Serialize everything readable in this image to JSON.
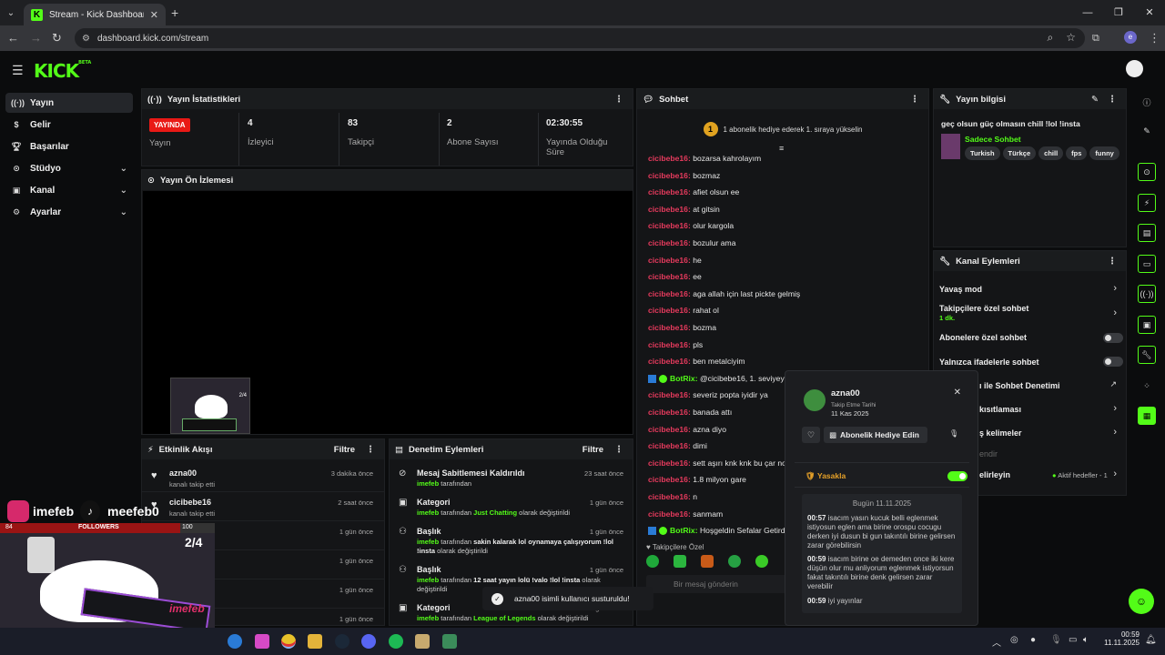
{
  "browser": {
    "tab_title": "Stream - Kick Dashboard",
    "url": "dashboard.kick.com/stream",
    "profile_initial": "e"
  },
  "nav": {
    "items": [
      {
        "label": "Yayın",
        "icon": "broadcast-icon"
      },
      {
        "label": "Gelir",
        "icon": "dollar-icon"
      },
      {
        "label": "Başarılar",
        "icon": "trophy-icon"
      },
      {
        "label": "Stüdyo",
        "icon": "studio-icon"
      },
      {
        "label": "Kanal",
        "icon": "channel-icon"
      },
      {
        "label": "Ayarlar",
        "icon": "gear-icon"
      }
    ]
  },
  "stats": {
    "title": "Yayın İstatistikleri",
    "live_badge": "YAYINDA",
    "live_label": "Yayın",
    "viewers_value": "4",
    "viewers_label": "İzleyici",
    "followers_value": "83",
    "followers_label": "Takipçi",
    "subs_value": "2",
    "subs_label": "Abone Sayısı",
    "uptime_value": "02:30:55",
    "uptime_label": "Yayında Olduğu Süre"
  },
  "preview": {
    "title": "Yayın Ön İzlemesi"
  },
  "activity": {
    "title": "Etkinlik Akışı",
    "filter": "Filtre",
    "events": [
      {
        "name": "azna00",
        "sub": "kanalı takip etti",
        "time": "3 dakika önce"
      },
      {
        "name": "cicibebe16",
        "sub": "kanalı takip etti",
        "time": "2 saat önce"
      },
      {
        "name": "",
        "sub": "",
        "time": "1 gün önce"
      },
      {
        "name": "",
        "sub": "",
        "time": "1 gün önce"
      },
      {
        "name": "",
        "sub": "",
        "time": "1 gün önce"
      },
      {
        "name": "",
        "sub": "",
        "time": "1 gün önce"
      }
    ]
  },
  "moderation": {
    "title": "Denetim Eylemleri",
    "filter": "Filtre",
    "items": [
      {
        "title": "Mesaj Sabitlemesi Kaldırıldı",
        "user": "imefeb",
        "text": "tarafından",
        "time": "23 saat önce"
      },
      {
        "title": "Kategori",
        "user": "imefeb",
        "text": "tarafından",
        "highlight": "Just Chatting",
        "tail": "olarak değiştirildi",
        "time": "1 gün önce"
      },
      {
        "title": "Başlık",
        "user": "imefeb",
        "text": "tarafından",
        "highlight2": "sakin kalarak lol oynamaya çalışıyorum !lol !insta",
        "tail": "olarak değiştirildi",
        "time": "1 gün önce"
      },
      {
        "title": "Başlık",
        "user": "imefeb",
        "text": "tarafından",
        "highlight2": "12 saat yayın lolü !valo !lol !insta",
        "tail": "olarak değiştirildi",
        "time": "1 gün önce"
      },
      {
        "title": "Kategori",
        "user": "imefeb",
        "text": "tarafından",
        "highlight": "League of Legends",
        "tail": "olarak değiştirildi",
        "time": "1 gün önce"
      }
    ]
  },
  "chat": {
    "title": "Sohbet",
    "gift_banner": "1 abonelik hediye ederek 1. sıraya yükselin",
    "gift_rank": "1",
    "messages": [
      {
        "user": "cicibebe16:",
        "text": "bozarsa kahrolayım"
      },
      {
        "user": "cicibebe16:",
        "text": "bozmaz"
      },
      {
        "user": "cicibebe16:",
        "text": "afiet olsun ee"
      },
      {
        "user": "cicibebe16:",
        "text": "at gitsin"
      },
      {
        "user": "cicibebe16:",
        "text": "olur kargola"
      },
      {
        "user": "cicibebe16:",
        "text": "bozulur ama"
      },
      {
        "user": "cicibebe16:",
        "text": "he"
      },
      {
        "user": "cicibebe16:",
        "text": "ee"
      },
      {
        "user": "cicibebe16:",
        "text": "aga allah için last pickte gelmiş"
      },
      {
        "user": "cicibebe16:",
        "text": "rahat ol"
      },
      {
        "user": "cicibebe16:",
        "text": "bozma"
      },
      {
        "user": "cicibebe16:",
        "text": "pls"
      },
      {
        "user": "cicibebe16:",
        "text": "ben metalciyim"
      },
      {
        "user": "BotRix:",
        "text": "@cicibebe16, 1. seviyeye y",
        "bot": true
      },
      {
        "user": "cicibebe16:",
        "text": "severiz popta iyidir ya"
      },
      {
        "user": "cicibebe16:",
        "text": "banada attı"
      },
      {
        "user": "cicibebe16:",
        "text": "azna diyo"
      },
      {
        "user": "cicibebe16:",
        "text": "dimi"
      },
      {
        "user": "cicibebe16:",
        "text": "sett aşırı knk knk bu çar norm"
      },
      {
        "user": "cicibebe16:",
        "text": "1.8 milyon gare"
      },
      {
        "user": "cicibebe16:",
        "text": "n"
      },
      {
        "user": "cicibebe16:",
        "text": "sanmam"
      },
      {
        "user": "BotRix:",
        "text": "Hoşgeldin Sefalar Getirdin",
        "bot": true
      }
    ],
    "followers_only": "Takipçilere Özel",
    "input_placeholder": "Bir mesaj gönderin"
  },
  "popover": {
    "username": "azna00",
    "follow_label": "Takip Etme Tarihi",
    "follow_date": "11 Kas 2025",
    "gift_button": "Abonelik Hediye Edin",
    "ban_label": "Yasakla",
    "date_header": "Bugün 11.11.2025",
    "messages": [
      {
        "time": "00:57",
        "text": "isacım yasın kucuk belli eglenmek istiyosun eglen ama birine orospu cocugu derken iyi dusun bi gun takıntılı birine gelirsen zarar görebilirsin"
      },
      {
        "time": "00:59",
        "text": "isacım birine oe demeden once iki kere düşün olur mu anliyorum eglenmek istiyorsun fakat takıntılı birine denk gelirsen zarar verebilir"
      },
      {
        "time": "00:59",
        "text": "iyi yayınlar"
      }
    ]
  },
  "streaminfo": {
    "title": "Yayın bilgisi",
    "stream_title": "geç olsun güç olmasın chill !lol !insta",
    "category": "Sadece Sohbet",
    "tags": [
      "Turkish",
      "Türkçe",
      "chill",
      "fps",
      "funny"
    ]
  },
  "channel_actions": {
    "title": "Kanal Eylemleri",
    "slow_mode": "Yavaş mod",
    "followers_chat": "Takipçilere özel sohbet",
    "followers_chat_sub": "1 dk.",
    "subs_chat": "Abonelere özel sohbet",
    "emote_chat": "Yalnızca ifadelerle sohbet",
    "ai_moderation": "ı ile Sohbet Denetimi",
    "restrictions": "kısıtlaması",
    "words": "ş kelimeler",
    "recommend": "endir",
    "goals": "elirleyin",
    "goals_status": "Aktif hedefler - 1"
  },
  "overlay": {
    "insta_name": "imefeb",
    "tiktok_name": "meefeb0",
    "followers_label": "FOLLOWERS",
    "followers_count": "84",
    "followers_goal": "100",
    "counter": "2/4",
    "watermark": "imefeb"
  },
  "toast": {
    "text": "azna00 isimli kullanıcı susturuldu!"
  },
  "taskbar": {
    "time": "00:59",
    "date": "11.11.2025"
  },
  "colors": {
    "kick_green": "#53fc18",
    "live_red": "#e91916",
    "chat_user": "#e63a5d"
  }
}
